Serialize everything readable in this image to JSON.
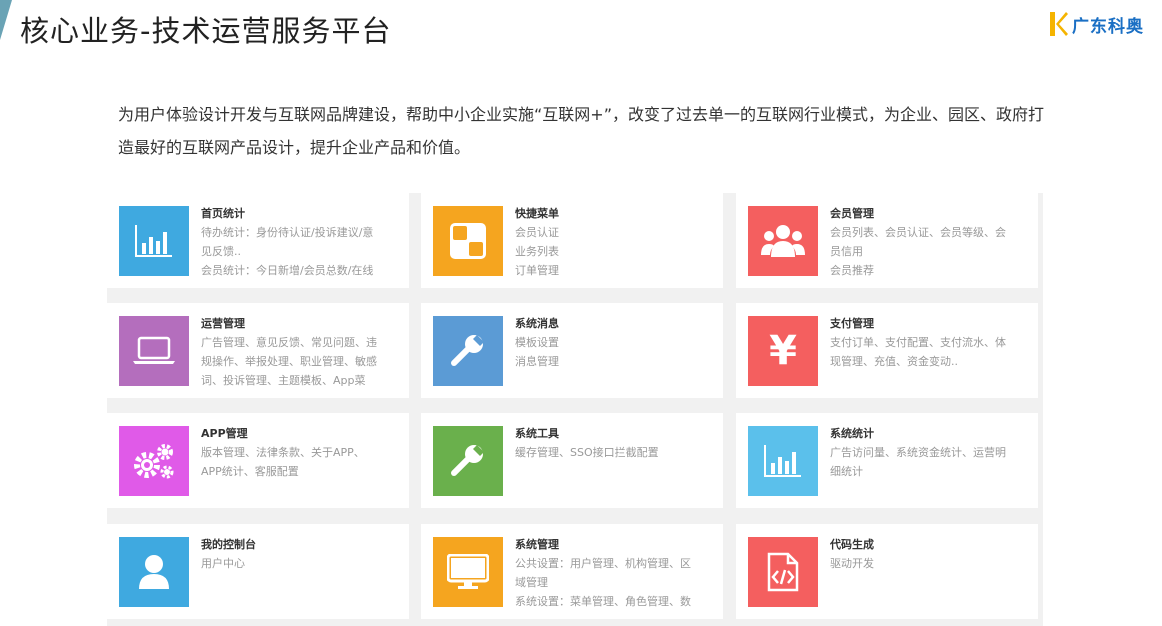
{
  "header": {
    "title": "核心业务-技术运营服务平台",
    "logo_text": "广东科奥"
  },
  "intro": "为用户体验设计开发与互联网品牌建设，帮助中小企业实施“互联网+”，改变了过去单一的互联网行业模式，为企业、园区、政府打造最好的互联网产品设计，提升企业产品和价值。",
  "cards": [
    {
      "title": "首页统计",
      "desc": "待办统计：身份待认证/投诉建议/意\n见反馈..\n会员统计：今日新增/会员总数/在线",
      "icon": "bar-chart-icon",
      "color": "#3fa9e0"
    },
    {
      "title": "快捷菜单",
      "desc": "会员认证\n业务列表\n订单管理",
      "icon": "quick-menu-icon",
      "color": "#f5a51f"
    },
    {
      "title": "会员管理",
      "desc": "会员列表、会员认证、会员等级、会\n员信用\n会员推荐",
      "icon": "members-icon",
      "color": "#f45f5f"
    },
    {
      "title": "运营管理",
      "desc": "广告管理、意见反馈、常见问题、违\n规操作、举报处理、职业管理、敏感\n词、投诉管理、主题模板、App菜",
      "icon": "laptop-icon",
      "color": "#b46ebd"
    },
    {
      "title": "系统消息",
      "desc": "模板设置\n消息管理",
      "icon": "wrench-icon",
      "color": "#5b9bd5"
    },
    {
      "title": "支付管理",
      "desc": "支付订单、支付配置、支付流水、体\n现管理、充值、资金变动..",
      "icon": "yen-icon",
      "color": "#f45f5f"
    },
    {
      "title": "APP管理",
      "desc": "版本管理、法律条款、关于APP、\nAPP统计、客服配置",
      "icon": "gears-icon",
      "color": "#e05ae8"
    },
    {
      "title": "系统工具",
      "desc": "缓存管理、SSO接口拦截配置",
      "icon": "wrench-icon",
      "color": "#6ab04c"
    },
    {
      "title": "系统统计",
      "desc": "广告访问量、系统资金统计、运营明\n细统计",
      "icon": "bar-chart-icon",
      "color": "#5bc0eb"
    },
    {
      "title": "我的控制台",
      "desc": "用户中心",
      "icon": "user-icon",
      "color": "#3fa9e0"
    },
    {
      "title": "系统管理",
      "desc": "公共设置：用户管理、机构管理、区\n域管理\n系统设置：菜单管理、角色管理、数",
      "icon": "monitor-icon",
      "color": "#f5a51f"
    },
    {
      "title": "代码生成",
      "desc": "驱动开发",
      "icon": "code-file-icon",
      "color": "#f45f5f"
    }
  ]
}
